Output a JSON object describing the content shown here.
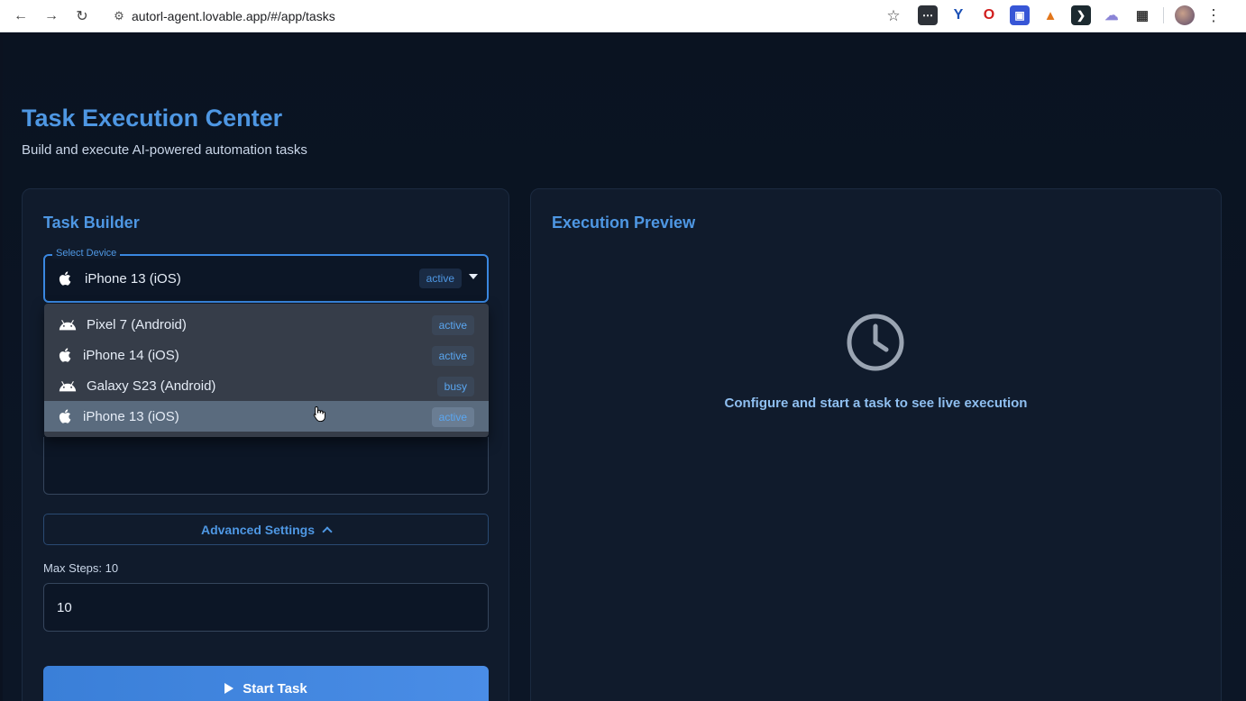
{
  "browser": {
    "url": "autorl-agent.lovable.app/#/app/tasks",
    "nav": {
      "back_icon": "arrow-left",
      "forward_icon": "arrow-right",
      "reload_icon": "reload"
    },
    "extensions": [
      "bitwarden-icon",
      "yandex-icon",
      "opera-icon",
      "authenticator-icon",
      "metamask-icon",
      "prompt-icon",
      "cloud-icon",
      "puzzle-icon"
    ]
  },
  "page": {
    "title": "Task Execution Center",
    "subtitle": "Build and execute AI-powered automation tasks"
  },
  "builder": {
    "title": "Task Builder",
    "device_select": {
      "legend": "Select Device",
      "value": "iPhone 13 (iOS)",
      "status": "active",
      "icon": "apple-icon"
    },
    "device_options": [
      {
        "label": "Pixel 7 (Android)",
        "status": "active",
        "icon": "android-icon"
      },
      {
        "label": "iPhone 14 (iOS)",
        "status": "active",
        "icon": "apple-icon"
      },
      {
        "label": "Galaxy S23 (Android)",
        "status": "busy",
        "icon": "android-icon"
      },
      {
        "label": "iPhone 13 (iOS)",
        "status": "active",
        "icon": "apple-icon",
        "selected": true
      }
    ],
    "advanced_label": "Advanced Settings",
    "max_steps_label": "Max Steps: 10",
    "max_steps_value": "10",
    "start_label": "Start Task"
  },
  "preview": {
    "title": "Execution Preview",
    "message": "Configure and start a task to see live execution",
    "icon": "clock-icon"
  },
  "colors": {
    "accent": "#4e97e3",
    "background": "#0b1220",
    "card": "#101b2c",
    "button": "#3a7fd8"
  }
}
